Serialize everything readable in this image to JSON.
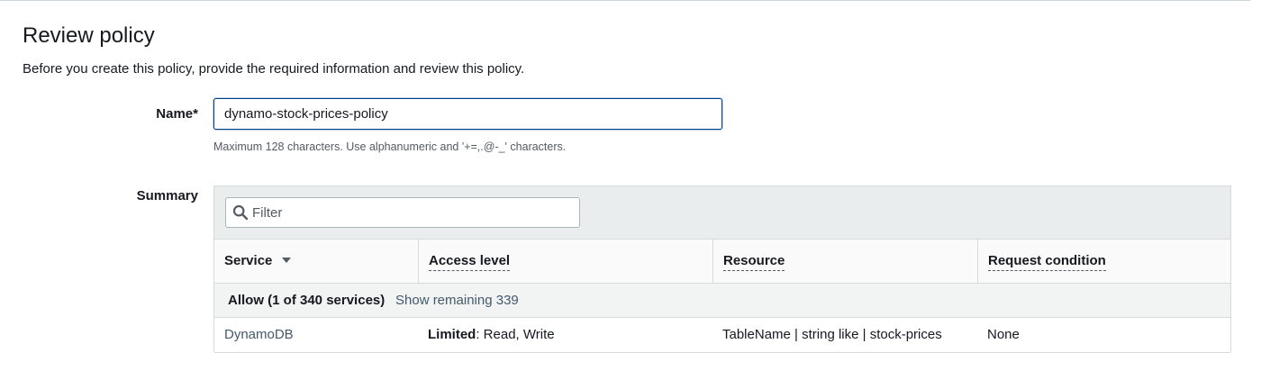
{
  "header": {
    "title": "Review policy",
    "description": "Before you create this policy, provide the required information and review this policy."
  },
  "name_field": {
    "label": "Name*",
    "value": "dynamo-stock-prices-policy",
    "helper": "Maximum 128 characters. Use alphanumeric and '+=,.@-_' characters."
  },
  "summary": {
    "label": "Summary",
    "filter_placeholder": "Filter",
    "columns": [
      "Service",
      "Access level",
      "Resource",
      "Request condition"
    ],
    "allow_label": "Allow (1 of 340 services)",
    "show_remaining": "Show remaining 339",
    "rows": [
      {
        "service": "DynamoDB",
        "access_level_strong": "Limited",
        "access_level_detail": ": Read, Write",
        "resource": "TableName | string like | stock-prices",
        "request_condition": "None"
      }
    ]
  },
  "icons": {
    "filter": "search-icon",
    "sort": "caret-down-icon"
  },
  "colors": {
    "link": "#44596b",
    "input_focus_border": "#00458a",
    "table_header_bg": "#eaeded"
  }
}
